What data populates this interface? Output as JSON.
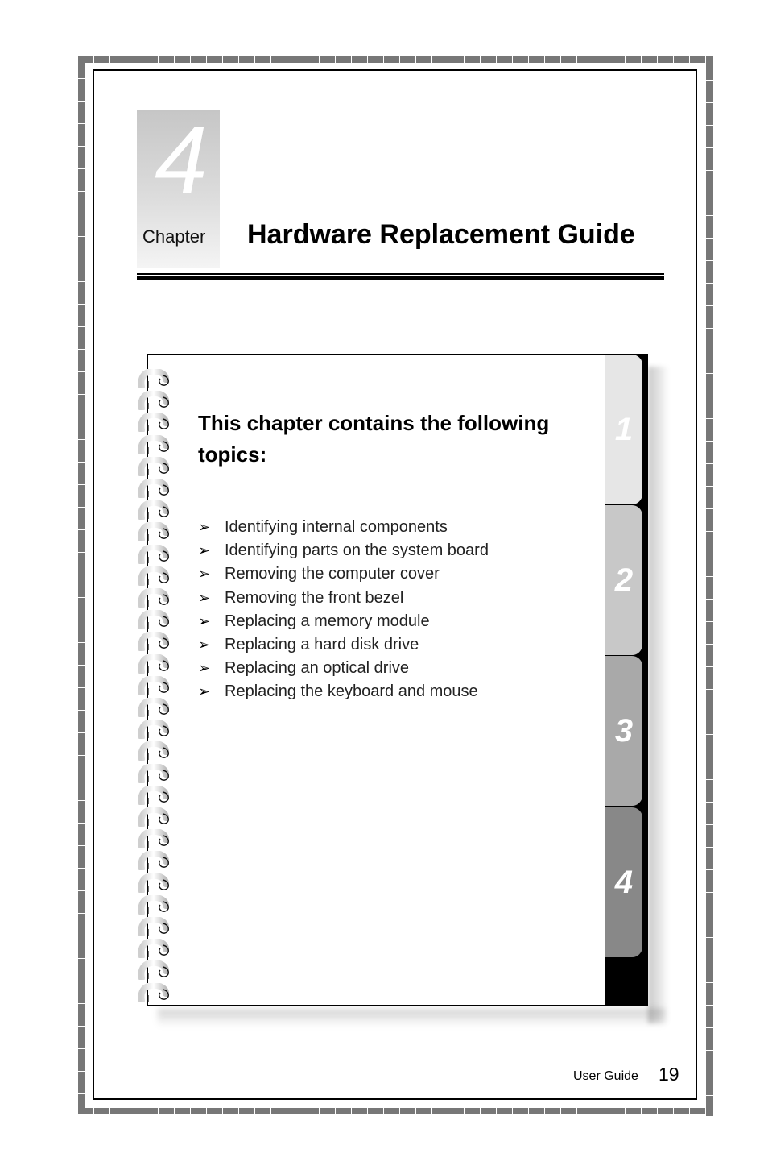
{
  "chapter": {
    "number": "4",
    "label": "Chapter",
    "title": "Hardware Replacement Guide"
  },
  "notebook": {
    "heading": "This chapter contains the following topics:",
    "bullet_glyph": "➢",
    "topics": [
      "Identifying internal components",
      "Identifying parts on the system board",
      "Removing the computer cover",
      "Removing the front bezel",
      "Replacing a memory module",
      "Replacing a hard disk drive",
      "Replacing an optical drive",
      "Replacing the keyboard and mouse"
    ],
    "tabs": [
      {
        "label": "1",
        "color": "#e6e6e6"
      },
      {
        "label": "2",
        "color": "#c8c8c8"
      },
      {
        "label": "3",
        "color": "#a9a9a9"
      },
      {
        "label": "4",
        "color": "#888888"
      }
    ],
    "ring_count": 29,
    "icons": {
      "rings": "spiral-binding-icon"
    }
  },
  "footer": {
    "label": "User Guide",
    "page_number": "19"
  }
}
